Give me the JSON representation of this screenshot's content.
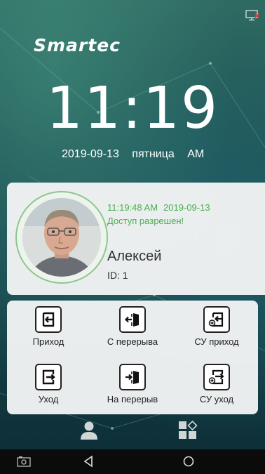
{
  "header": {
    "logo_text": "Smartec",
    "status_icon": "monitor-disconnected-icon"
  },
  "clock": {
    "time": "11:19",
    "date": "2019-09-13",
    "weekday": "пятница",
    "ampm": "AM"
  },
  "recognition": {
    "time": "11:19:48 AM",
    "date": "2019-09-13",
    "status": "Доступ разрешен!",
    "name": "Алексей",
    "id_label": "ID:",
    "id_value": "1"
  },
  "actions": [
    {
      "label": "Приход",
      "icon": "enter-icon"
    },
    {
      "label": "С перерыва",
      "icon": "door-enter-icon"
    },
    {
      "label": "СУ приход",
      "icon": "add-enter-icon"
    },
    {
      "label": "Уход",
      "icon": "exit-icon"
    },
    {
      "label": "На перерыв",
      "icon": "door-exit-icon"
    },
    {
      "label": "СУ уход",
      "icon": "add-exit-icon"
    }
  ],
  "tabs": [
    {
      "icon": "user-icon"
    },
    {
      "icon": "apps-icon"
    }
  ],
  "navbar": [
    {
      "icon": "screenshot-icon"
    },
    {
      "icon": "back-icon"
    },
    {
      "icon": "home-icon"
    }
  ],
  "colors": {
    "accent_green": "#4caf50",
    "panel_bg": "#f2f4f4"
  }
}
